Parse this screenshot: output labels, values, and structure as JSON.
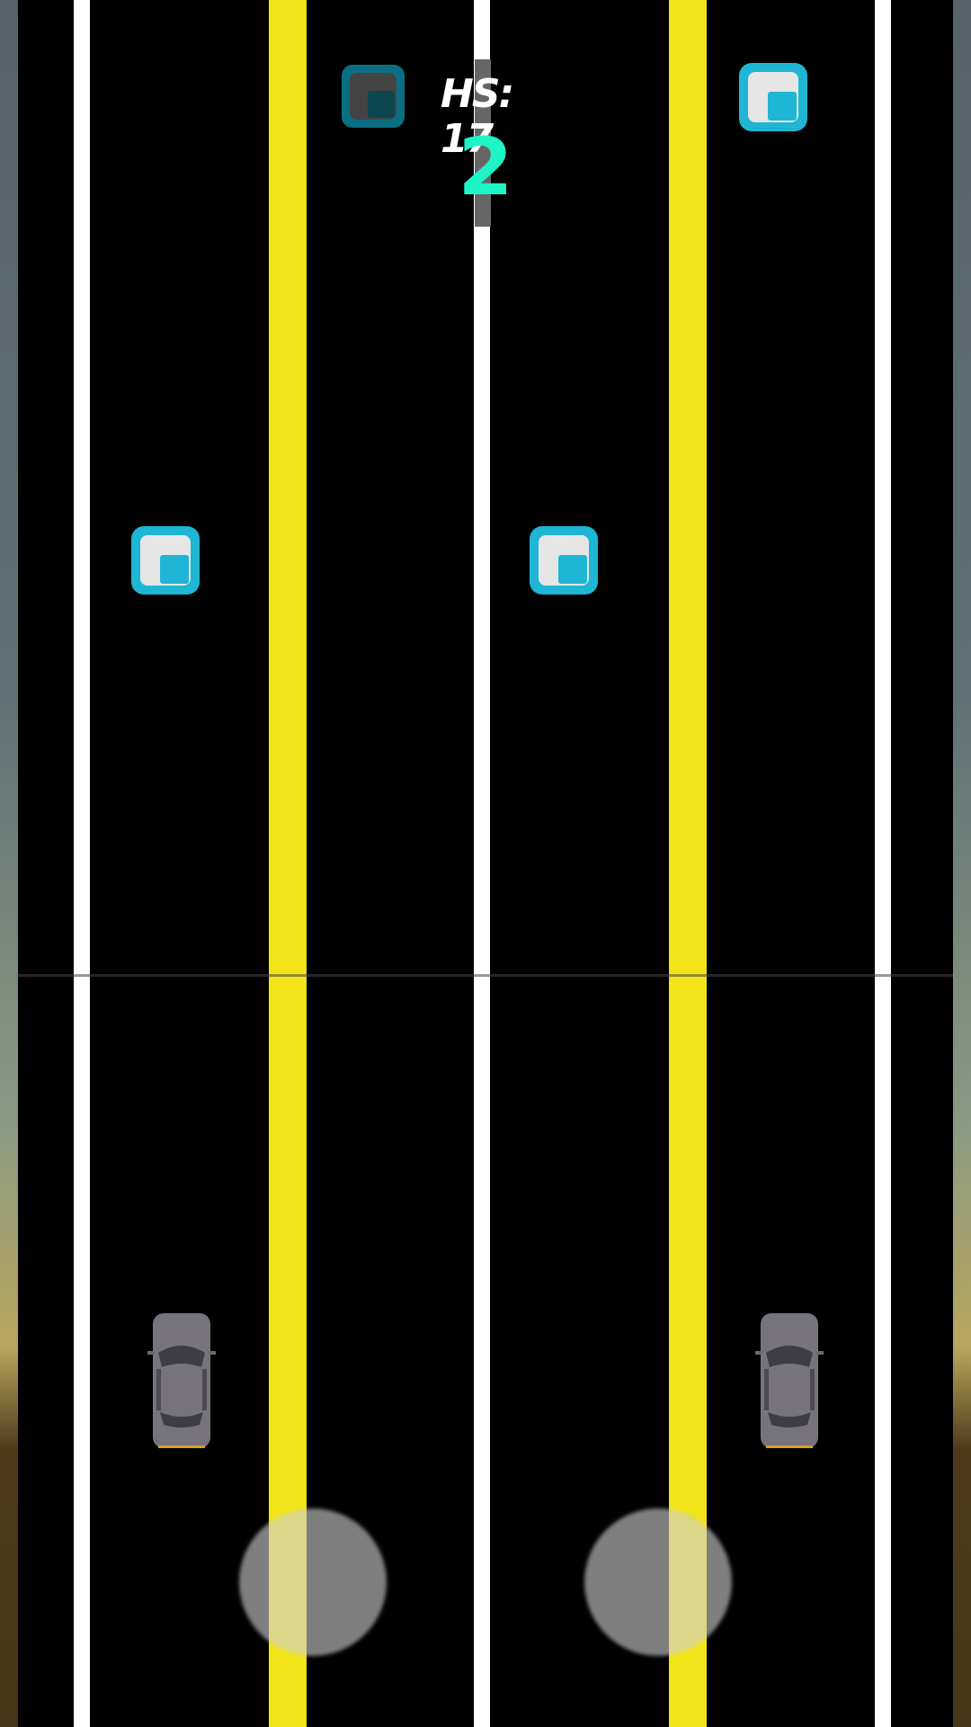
{
  "hud": {
    "high_score_label": "HS: 17",
    "score": "2"
  },
  "icons": {
    "pause": "pause-icon",
    "token": "square-token-icon",
    "car": "car-icon",
    "touch": "touch-zone"
  },
  "colors": {
    "road": "#000000",
    "white_line": "#ffffff",
    "yellow_line": "#f1e418",
    "token_blue": "#1eb6d4",
    "score_teal": "#1ff4c7",
    "car_gray": "#77737c"
  }
}
